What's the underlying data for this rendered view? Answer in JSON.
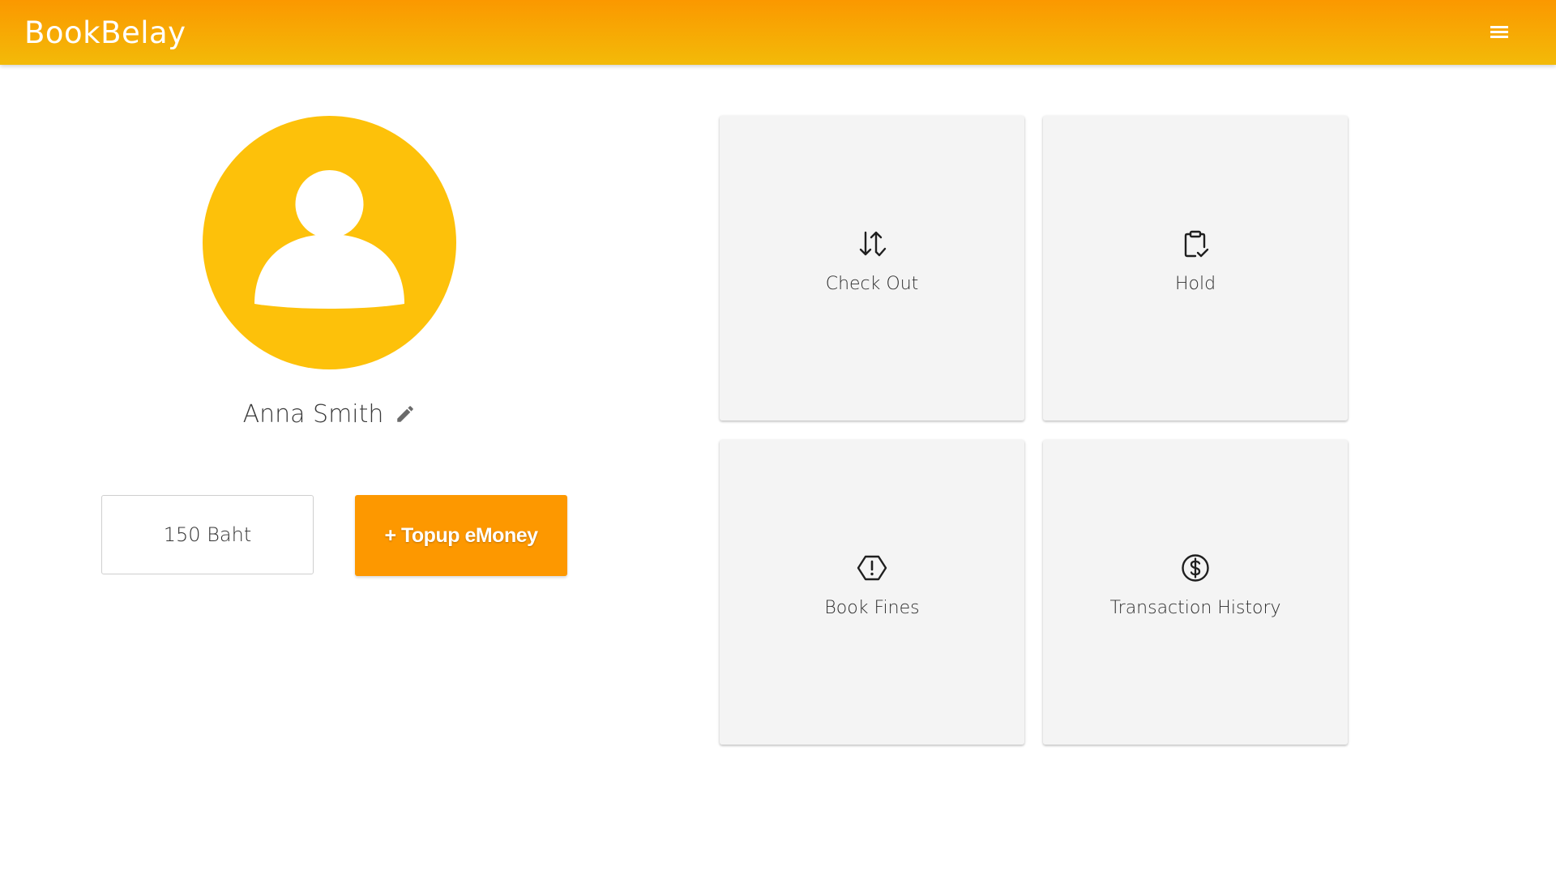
{
  "app_bar": {
    "brand": "BookBelay",
    "menu_icon": "hamburger-menu-icon",
    "gradient_top": "#fb9800",
    "gradient_bottom": "#f3ba08"
  },
  "profile": {
    "avatar_icon": "user-avatar-icon",
    "avatar_color": "#fdc10a",
    "name": "Anna Smith",
    "edit_icon": "pencil-icon"
  },
  "wallet": {
    "balance": "150 Baht",
    "topup_label": "+ Topup eMoney",
    "topup_color": "#fd9800"
  },
  "cards": [
    {
      "label": "Check Out",
      "icon": "sort-arrows-check-icon"
    },
    {
      "label": "Hold",
      "icon": "clipboard-check-icon"
    },
    {
      "label": "Book Fines",
      "icon": "hexagon-alert-icon"
    },
    {
      "label": "Transaction History",
      "icon": "dollar-circle-icon"
    }
  ]
}
